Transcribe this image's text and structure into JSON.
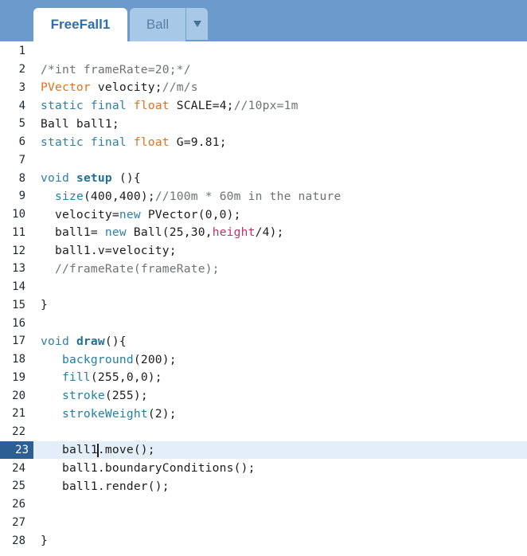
{
  "tabs": {
    "active": "FreeFall1",
    "inactive": "Ball"
  },
  "icons": {
    "dropdown": "triangle-down-icon"
  },
  "editor": {
    "current_line": 23,
    "lines": [
      {
        "n": "1",
        "tokens": []
      },
      {
        "n": "2",
        "tokens": [
          {
            "t": "/*int frameRate=20;*/",
            "c": "comment"
          }
        ]
      },
      {
        "n": "3",
        "tokens": [
          {
            "t": "PVector",
            "c": "type"
          },
          {
            "t": " velocity;",
            "c": "plain"
          },
          {
            "t": "//m/s",
            "c": "comment"
          }
        ]
      },
      {
        "n": "4",
        "tokens": [
          {
            "t": "static",
            "c": "keyword"
          },
          {
            "t": " ",
            "c": "plain"
          },
          {
            "t": "final",
            "c": "keyword"
          },
          {
            "t": " ",
            "c": "plain"
          },
          {
            "t": "float",
            "c": "type"
          },
          {
            "t": " SCALE=4;",
            "c": "plain"
          },
          {
            "t": "//10px=1m",
            "c": "comment"
          }
        ]
      },
      {
        "n": "5",
        "tokens": [
          {
            "t": "Ball ball1;",
            "c": "plain"
          }
        ]
      },
      {
        "n": "6",
        "tokens": [
          {
            "t": "static",
            "c": "keyword"
          },
          {
            "t": " ",
            "c": "plain"
          },
          {
            "t": "final",
            "c": "keyword"
          },
          {
            "t": " ",
            "c": "plain"
          },
          {
            "t": "float",
            "c": "type"
          },
          {
            "t": " G=9.81;",
            "c": "plain"
          }
        ]
      },
      {
        "n": "7",
        "tokens": []
      },
      {
        "n": "8",
        "tokens": [
          {
            "t": "void",
            "c": "keyword"
          },
          {
            "t": " ",
            "c": "plain"
          },
          {
            "t": "setup",
            "c": "bold"
          },
          {
            "t": " (){",
            "c": "plain"
          }
        ]
      },
      {
        "n": "9",
        "tokens": [
          {
            "t": "  ",
            "c": "plain"
          },
          {
            "t": "size",
            "c": "func"
          },
          {
            "t": "(400,400);",
            "c": "plain"
          },
          {
            "t": "//100m * 60m in the nature",
            "c": "comment"
          }
        ]
      },
      {
        "n": "10",
        "tokens": [
          {
            "t": "  velocity=",
            "c": "plain"
          },
          {
            "t": "new",
            "c": "keyword"
          },
          {
            "t": " PVector(0,0);",
            "c": "plain"
          }
        ]
      },
      {
        "n": "11",
        "tokens": [
          {
            "t": "  ball1= ",
            "c": "plain"
          },
          {
            "t": "new",
            "c": "keyword"
          },
          {
            "t": " Ball(25,30,",
            "c": "plain"
          },
          {
            "t": "height",
            "c": "builtin"
          },
          {
            "t": "/4);",
            "c": "plain"
          }
        ]
      },
      {
        "n": "12",
        "tokens": [
          {
            "t": "  ball1.v=velocity;",
            "c": "plain"
          }
        ]
      },
      {
        "n": "13",
        "tokens": [
          {
            "t": "  ",
            "c": "plain"
          },
          {
            "t": "//frameRate(frameRate);",
            "c": "comment"
          }
        ]
      },
      {
        "n": "14",
        "tokens": []
      },
      {
        "n": "15",
        "tokens": [
          {
            "t": "}",
            "c": "plain"
          }
        ]
      },
      {
        "n": "16",
        "tokens": []
      },
      {
        "n": "17",
        "tokens": [
          {
            "t": "void",
            "c": "keyword"
          },
          {
            "t": " ",
            "c": "plain"
          },
          {
            "t": "draw",
            "c": "bold"
          },
          {
            "t": "(){",
            "c": "plain"
          }
        ]
      },
      {
        "n": "18",
        "tokens": [
          {
            "t": "   ",
            "c": "plain"
          },
          {
            "t": "background",
            "c": "func"
          },
          {
            "t": "(200);",
            "c": "plain"
          }
        ]
      },
      {
        "n": "19",
        "tokens": [
          {
            "t": "   ",
            "c": "plain"
          },
          {
            "t": "fill",
            "c": "func"
          },
          {
            "t": "(255,0,0);",
            "c": "plain"
          }
        ]
      },
      {
        "n": "20",
        "tokens": [
          {
            "t": "   ",
            "c": "plain"
          },
          {
            "t": "stroke",
            "c": "func"
          },
          {
            "t": "(255);",
            "c": "plain"
          }
        ]
      },
      {
        "n": "21",
        "tokens": [
          {
            "t": "   ",
            "c": "plain"
          },
          {
            "t": "strokeWeight",
            "c": "func"
          },
          {
            "t": "(2);",
            "c": "plain"
          }
        ]
      },
      {
        "n": "22",
        "tokens": []
      },
      {
        "n": "23",
        "tokens": [
          {
            "t": "   ball1",
            "c": "plain"
          },
          {
            "t": "",
            "c": "caret"
          },
          {
            "t": ".move();",
            "c": "plain"
          }
        ]
      },
      {
        "n": "24",
        "tokens": [
          {
            "t": "   ball1.boundaryConditions();",
            "c": "plain"
          }
        ]
      },
      {
        "n": "25",
        "tokens": [
          {
            "t": "   ball1.render();",
            "c": "plain"
          }
        ]
      },
      {
        "n": "26",
        "tokens": []
      },
      {
        "n": "27",
        "tokens": []
      },
      {
        "n": "28",
        "tokens": [
          {
            "t": "}",
            "c": "plain"
          }
        ]
      }
    ]
  },
  "colors": {
    "tabbar": "#6b9bcb",
    "tab_active_text": "#2d6fad",
    "current_line": "#e3eef9",
    "current_line_number_bg": "#2c5f93",
    "keyword": "#2f7fa6",
    "type": "#e2701f",
    "comment": "#6c7278",
    "builtin": "#c1306a"
  }
}
